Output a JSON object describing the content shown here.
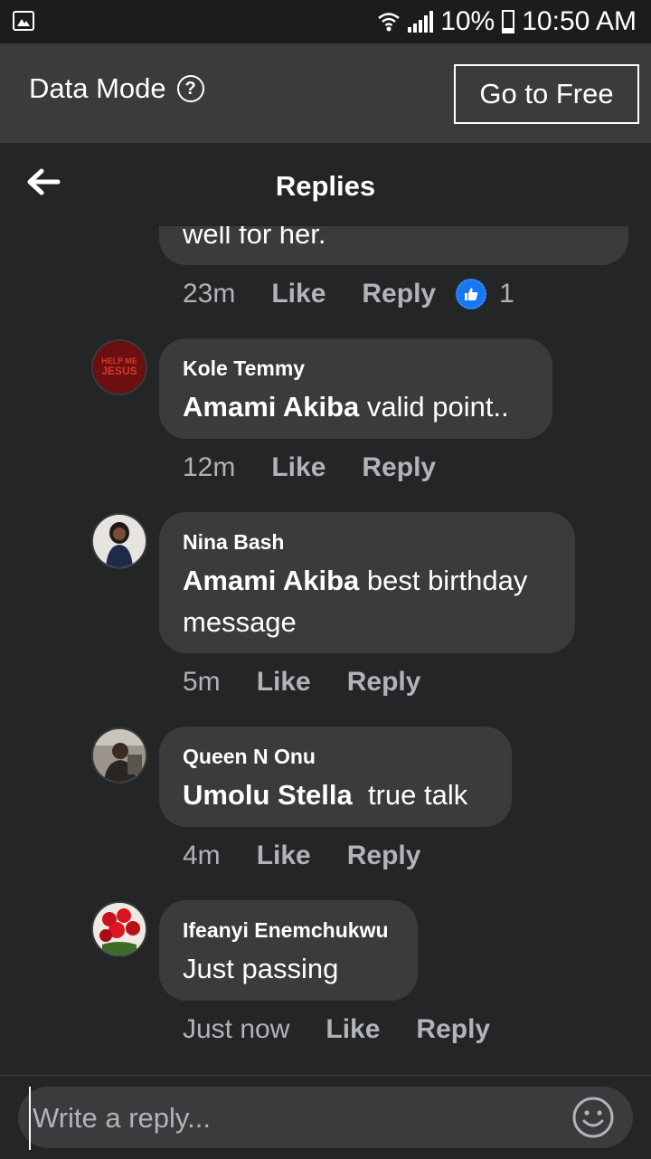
{
  "status_bar": {
    "battery": "10%",
    "time": "10:50 AM"
  },
  "data_mode": {
    "label": "Data Mode",
    "help_symbol": "?",
    "go_free_label": "Go to Free"
  },
  "header": {
    "title": "Replies"
  },
  "partial_comment": {
    "text": "well for her.",
    "time": "23m",
    "like_label": "Like",
    "reply_label": "Reply",
    "reaction_count": "1"
  },
  "replies": [
    {
      "author": "Kole Temmy",
      "mention": "Amami Akiba",
      "text": " valid point..",
      "time": "12m",
      "like_label": "Like",
      "reply_label": "Reply",
      "avatar_text": "HELP ME JESUS"
    },
    {
      "author": "Nina Bash",
      "mention": "Amami Akiba",
      "text": " best birthday message",
      "time": "5m",
      "like_label": "Like",
      "reply_label": "Reply"
    },
    {
      "author": "Queen N Onu",
      "mention": "Umolu Stella",
      "text": "  true talk",
      "time": "4m",
      "like_label": "Like",
      "reply_label": "Reply"
    },
    {
      "author": "Ifeanyi Enemchukwu",
      "mention": "",
      "text": "Just passing",
      "time": "Just now",
      "like_label": "Like",
      "reply_label": "Reply"
    }
  ],
  "composer": {
    "placeholder": "Write a reply..."
  },
  "colors": {
    "background": "#242526",
    "bubble": "#3a3b3c",
    "accent": "#1877f2"
  }
}
